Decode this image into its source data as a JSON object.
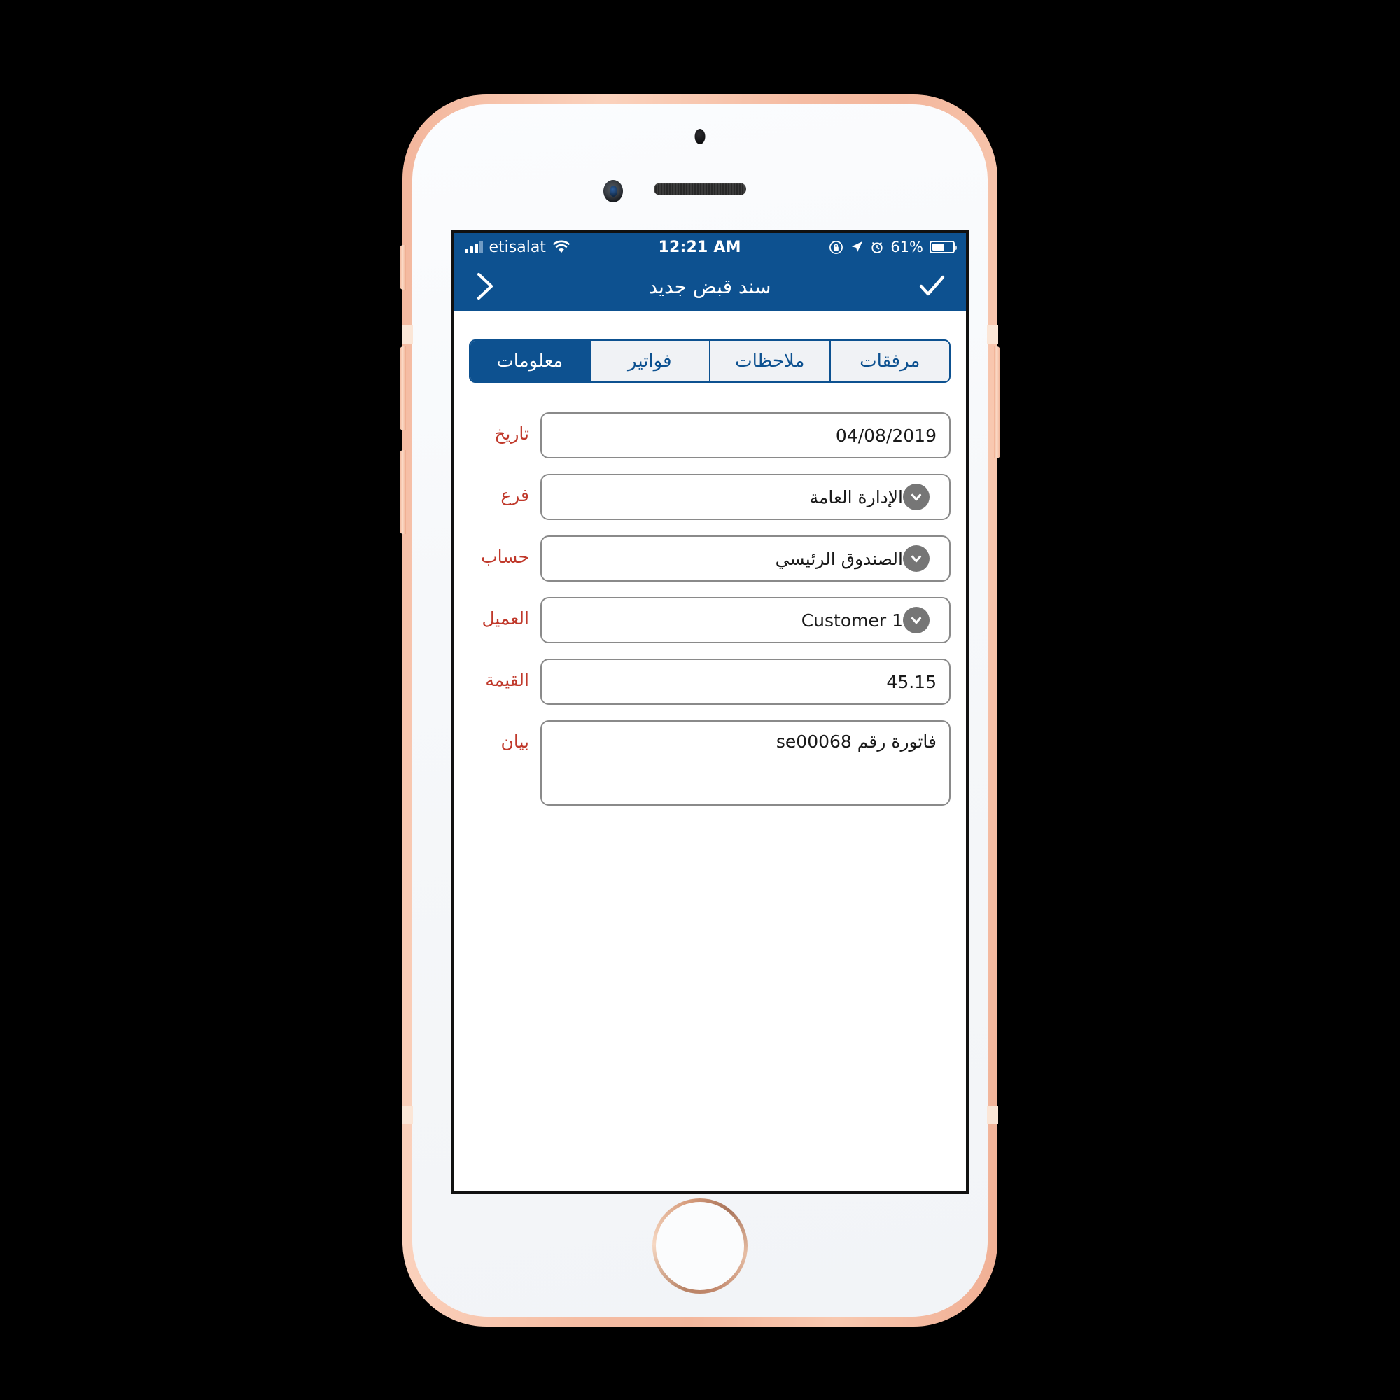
{
  "device": {
    "name": "iphone-rose-gold",
    "frame_color": "#f4bda3",
    "face_color": "#fbfcfe"
  },
  "status_bar": {
    "carrier": "etisalat",
    "signal_icon": "signal-bars-icon",
    "wifi_icon": "wifi-icon",
    "time": "12:21 AM",
    "rotation_lock_icon": "rotation-lock-icon",
    "location_icon": "location-arrow-icon",
    "alarm_icon": "alarm-clock-icon",
    "battery_percent": "61%",
    "battery_level": 61,
    "battery_icon": "battery-icon",
    "background_color": "#0d5190"
  },
  "nav_bar": {
    "confirm_icon": "check-icon",
    "title": "سند قبض جديد",
    "back_icon": "chevron-right-icon",
    "background_color": "#0d5190"
  },
  "tabs": {
    "items": [
      {
        "label": "مرفقات",
        "active": false
      },
      {
        "label": "ملاحظات",
        "active": false
      },
      {
        "label": "فواتير",
        "active": false
      },
      {
        "label": "معلومات",
        "active": true
      }
    ],
    "accent_color": "#0d5190",
    "inactive_background": "#f0f2f5"
  },
  "form": {
    "label_color": "#c0392b",
    "fields": [
      {
        "label": "تاريخ",
        "value": "04/08/2019",
        "type": "date",
        "has_dropdown": false,
        "tall": false,
        "ltr_value": true
      },
      {
        "label": "فرع",
        "value": "الإدارة العامة",
        "type": "select",
        "has_dropdown": true,
        "tall": false,
        "ltr_value": false
      },
      {
        "label": "حساب",
        "value": "الصندوق الرئيسي",
        "type": "select",
        "has_dropdown": true,
        "tall": false,
        "ltr_value": false
      },
      {
        "label": "العميل",
        "value": "Customer 1",
        "type": "select",
        "has_dropdown": true,
        "tall": false,
        "ltr_value": true
      },
      {
        "label": "القيمة",
        "value": "45.15",
        "type": "number",
        "has_dropdown": false,
        "tall": false,
        "ltr_value": true
      },
      {
        "label": "بيان",
        "value": "فاتورة رقم se00068",
        "type": "textarea",
        "has_dropdown": false,
        "tall": true,
        "ltr_value": false
      }
    ]
  }
}
